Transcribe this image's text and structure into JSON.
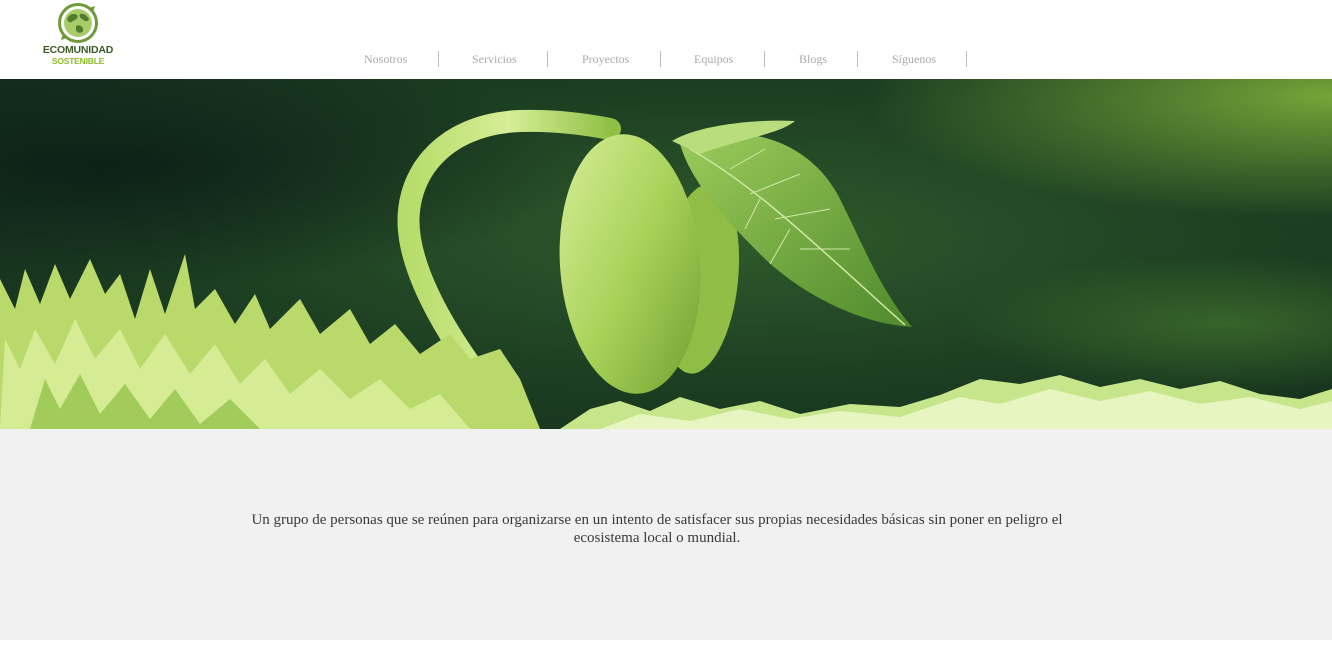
{
  "brand": {
    "line1": "ECOMUNIDAD",
    "line2": "SOSTENIBLE"
  },
  "nav": {
    "items": [
      {
        "label": "Nosotros"
      },
      {
        "label": "Servicios"
      },
      {
        "label": "Proyectos"
      },
      {
        "label": "Equipos"
      },
      {
        "label": "Blogs"
      },
      {
        "label": "Síguenos"
      }
    ]
  },
  "hero": {
    "image": "seedling-sprout-image"
  },
  "intro": {
    "text": "Un grupo de personas que se reúnen para organizarse en un intento de satisfacer sus propias necesidades básicas sin poner en peligro el ecosistema local o mundial."
  },
  "colors": {
    "brand_dark": "#3f5a2a",
    "brand_light": "#8dbb2e",
    "nav_text": "#a9a9a9",
    "intro_bg": "#f1f1f1"
  }
}
